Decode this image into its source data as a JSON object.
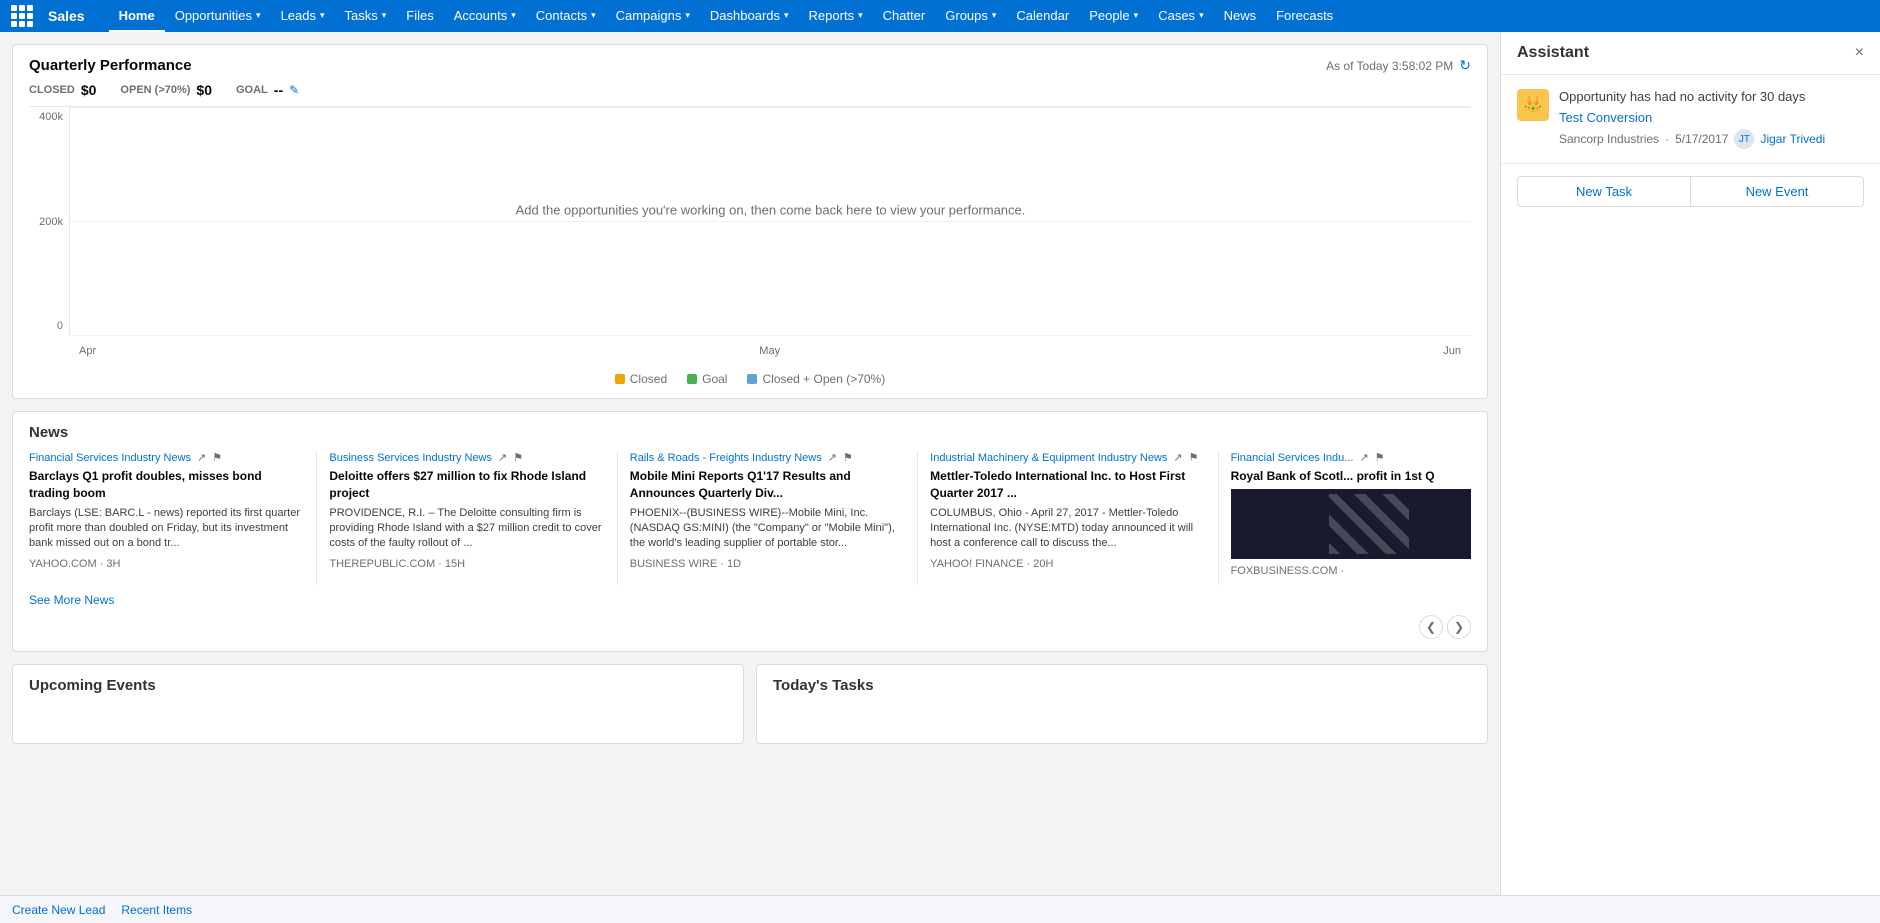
{
  "nav": {
    "app_name": "Sales",
    "items": [
      {
        "label": "Home",
        "active": true,
        "has_dropdown": false
      },
      {
        "label": "Opportunities",
        "active": false,
        "has_dropdown": true
      },
      {
        "label": "Leads",
        "active": false,
        "has_dropdown": true
      },
      {
        "label": "Tasks",
        "active": false,
        "has_dropdown": true
      },
      {
        "label": "Files",
        "active": false,
        "has_dropdown": false
      },
      {
        "label": "Accounts",
        "active": false,
        "has_dropdown": true
      },
      {
        "label": "Contacts",
        "active": false,
        "has_dropdown": true
      },
      {
        "label": "Campaigns",
        "active": false,
        "has_dropdown": true
      },
      {
        "label": "Dashboards",
        "active": false,
        "has_dropdown": true
      },
      {
        "label": "Reports",
        "active": false,
        "has_dropdown": true
      },
      {
        "label": "Chatter",
        "active": false,
        "has_dropdown": false
      },
      {
        "label": "Groups",
        "active": false,
        "has_dropdown": true
      },
      {
        "label": "Calendar",
        "active": false,
        "has_dropdown": false
      },
      {
        "label": "People",
        "active": false,
        "has_dropdown": true
      },
      {
        "label": "Cases",
        "active": false,
        "has_dropdown": true
      },
      {
        "label": "News",
        "active": false,
        "has_dropdown": false
      },
      {
        "label": "Forecasts",
        "active": false,
        "has_dropdown": false
      }
    ]
  },
  "quarterly": {
    "title": "Quarterly Performance",
    "timestamp": "As of Today 3:58:02 PM",
    "closed_label": "CLOSED",
    "closed_value": "$0",
    "open_label": "OPEN (>70%)",
    "open_value": "$0",
    "goal_label": "GOAL",
    "goal_value": "--",
    "chart_placeholder": "Add the opportunities you're working on, then come back here to view your performance.",
    "y_labels": [
      "400k",
      "200k",
      "0"
    ],
    "x_labels": [
      "Apr",
      "May",
      "Jun"
    ],
    "legend": [
      {
        "label": "Closed",
        "color": "#f0a500"
      },
      {
        "label": "Goal",
        "color": "#4caf50"
      },
      {
        "label": "Closed + Open (>70%)",
        "color": "#5ba4cf"
      }
    ]
  },
  "news": {
    "title": "News",
    "see_more": "See More News",
    "items": [
      {
        "source": "Financial Services Industry News",
        "headline": "Barclays Q1 profit doubles, misses bond trading boom",
        "body": "Barclays (LSE: BARC.L - news) reported its first quarter profit more than doubled on Friday, but its investment bank missed out on a bond tr...",
        "footer": "YAHOO.COM · 3h",
        "has_image": false
      },
      {
        "source": "Business Services Industry News",
        "headline": "Deloitte offers $27 million to fix Rhode Island project",
        "body": "PROVIDENCE, R.I. – The Deloitte consulting firm is providing Rhode Island with a $27 million credit to cover costs of the faulty rollout of ...",
        "footer": "THEREPUBLIC.COM · 15h",
        "has_image": false
      },
      {
        "source": "Rails & Roads - Freights Industry News",
        "headline": "Mobile Mini Reports Q1'17 Results and Announces Quarterly Div...",
        "body": "PHOENIX--(BUSINESS WIRE)--Mobile Mini, Inc. (NASDAQ GS:MINI) (the \"Company\" or \"Mobile Mini\"), the world's leading supplier of portable stor...",
        "footer": "BUSINESS WIRE · 1d",
        "has_image": false
      },
      {
        "source": "Industrial Machinery & Equipment Industry News",
        "headline": "Mettler-Toledo International Inc. to Host First Quarter 2017 ...",
        "body": "COLUMBUS, Ohio - April 27, 2017 - Mettler-Toledo International Inc. (NYSE:MTD) today announced it will host a conference call to discuss the...",
        "footer": "YAHOO! FINANCE · 20h",
        "has_image": false
      },
      {
        "source": "Financial Services Indu...",
        "headline": "Royal Bank of Scotl... profit in 1st Q",
        "body": "",
        "footer": "FOXBUSINESS.COM · ",
        "has_image": true
      }
    ]
  },
  "upcoming_events": {
    "title": "Upcoming Events"
  },
  "todays_tasks": {
    "title": "Today's Tasks"
  },
  "assistant": {
    "title": "Assistant",
    "close_icon": "×",
    "notification_text": "Opportunity has had no activity for 30 days",
    "opportunity_link": "Test Conversion",
    "company": "Sancorp Industries",
    "date": "5/17/2017",
    "user": "Jigar Trivedi",
    "new_task_label": "New Task",
    "new_event_label": "New Event"
  },
  "bottom_bar": {
    "create_new_lead": "Create New Lead",
    "recent_items": "Recent Items"
  }
}
